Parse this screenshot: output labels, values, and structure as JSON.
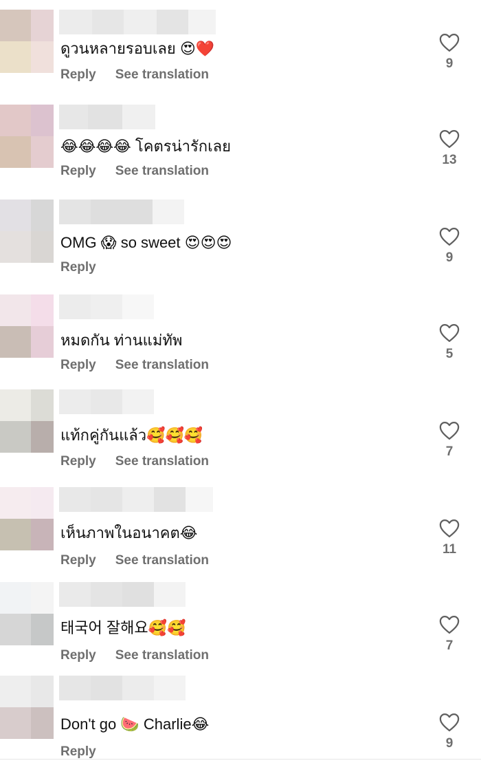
{
  "comments": [
    {
      "text": "ดูวนหลายรอบเลย 😍❤️",
      "reply_label": "Reply",
      "translate_label": "See translation",
      "likes": "9",
      "avatar_colors": [
        "#d6c6bc",
        "#e6d3d5",
        "#ebe0c9",
        "#f0e0dc"
      ],
      "name_blocks": [
        "#ececec",
        "#e6e6e6",
        "#efefef",
        "#e4e4e4",
        "#f3f3f3"
      ]
    },
    {
      "text": "😂😂😂😂 โคตรน่ารักเลย",
      "reply_label": "Reply",
      "translate_label": "See translation",
      "likes": "13",
      "avatar_colors": [
        "#e2c8c8",
        "#dcc2cf",
        "#d8c3b2",
        "#e4cccf"
      ],
      "name_blocks": [
        "#e7e7e7",
        "#e2e2e2",
        "#f0f0f0"
      ]
    },
    {
      "text": "OMG 😱 so sweet 😍😍😍",
      "reply_label": "Reply",
      "translate_label": "",
      "likes": "9",
      "avatar_colors": [
        "#e2e0e4",
        "#d7d7d7",
        "#e4e0de",
        "#d9d6d3"
      ],
      "name_blocks": [
        "#e4e4e4",
        "#dedede",
        "#f3f3f3"
      ]
    },
    {
      "text": "หมดกัน ท่านแม่ทัพ",
      "reply_label": "Reply",
      "translate_label": "See translation",
      "likes": "5",
      "avatar_colors": [
        "#f2e6ea",
        "#f4dde9",
        "#c9bdb5",
        "#e6cdd7"
      ],
      "name_blocks": [
        "#ececec",
        "#efefef",
        "#f7f7f7"
      ]
    },
    {
      "text": "แท้กคู่กันแล้ว🥰🥰🥰",
      "reply_label": "Reply",
      "translate_label": "See translation",
      "likes": "7",
      "avatar_colors": [
        "#ecebe6",
        "#dcdcd6",
        "#c9c9c4",
        "#b8aeab"
      ],
      "name_blocks": [
        "#ececec",
        "#e8e8e8",
        "#f2f2f2"
      ]
    },
    {
      "text": "เห็นภาพในอนาคต😂",
      "reply_label": "Reply",
      "translate_label": "See translation",
      "likes": "11",
      "avatar_colors": [
        "#f6ecef",
        "#f5eaf0",
        "#c6c0b1",
        "#c8b4b8"
      ],
      "name_blocks": [
        "#e8e8e8",
        "#e5e5e5",
        "#eeeeee",
        "#e2e2e2",
        "#f6f6f6"
      ]
    },
    {
      "text": "태국어 잘해요🥰🥰",
      "reply_label": "Reply",
      "translate_label": "See translation",
      "likes": "7",
      "avatar_colors": [
        "#f1f3f5",
        "#f4f4f4",
        "#d6d6d6",
        "#c6c8c8"
      ],
      "name_blocks": [
        "#eaeaea",
        "#e4e4e4",
        "#e0e0e0",
        "#f3f3f3"
      ]
    },
    {
      "text": "Don't go 🍉 Charlie😂",
      "reply_label": "Reply",
      "translate_label": "",
      "likes": "9",
      "avatar_colors": [
        "#eeeeee",
        "#e8e8e8",
        "#d8cccc",
        "#ccc0bf"
      ],
      "name_blocks": [
        "#e6e6e6",
        "#e2e2e2",
        "#ececec",
        "#f3f3f3"
      ]
    }
  ]
}
